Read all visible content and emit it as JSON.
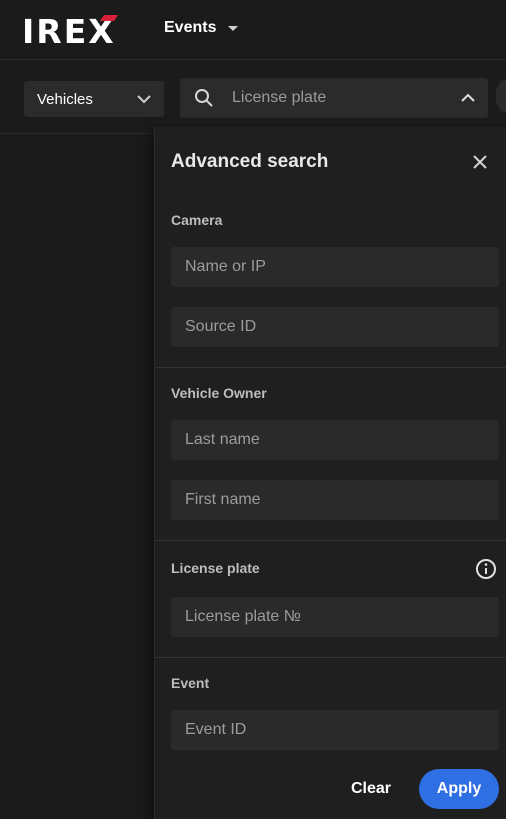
{
  "header": {
    "logo_text": "IREX",
    "nav_events_label": "Events"
  },
  "toolbar": {
    "category_select_value": "Vehicles",
    "search_placeholder": "License plate"
  },
  "advanced_search": {
    "title": "Advanced search",
    "camera": {
      "label": "Camera",
      "name_ip_placeholder": "Name or IP",
      "source_id_placeholder": "Source ID"
    },
    "vehicle_owner": {
      "label": "Vehicle Owner",
      "last_name_placeholder": "Last name",
      "first_name_placeholder": "First name"
    },
    "license_plate": {
      "label": "License plate",
      "number_placeholder": "License plate №"
    },
    "event": {
      "label": "Event",
      "event_id_placeholder": "Event ID"
    },
    "clear_label": "Clear",
    "apply_label": "Apply"
  },
  "icons": {
    "search": "search-icon",
    "chevron_down": "chevron-down-icon",
    "chevron_up": "chevron-up-icon",
    "close": "close-icon",
    "info": "info-icon",
    "caret_down": "caret-down-icon"
  },
  "colors": {
    "background": "#1b1b1b",
    "panel": "#1f1f1f",
    "field": "#2a2a2a",
    "accent": "#2f6fe4",
    "logo_accent": "#d8203a"
  }
}
